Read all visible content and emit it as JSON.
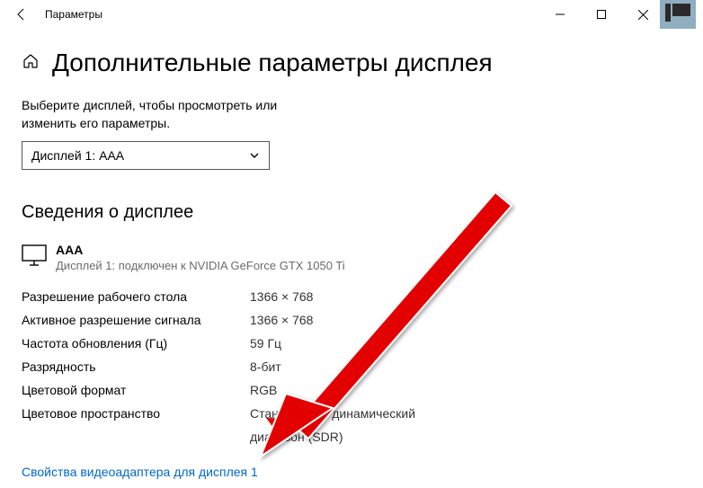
{
  "window": {
    "title": "Параметры"
  },
  "page": {
    "title": "Дополнительные параметры дисплея",
    "instruction": "Выберите дисплей, чтобы просмотреть или изменить его параметры."
  },
  "displaySelect": {
    "value": "Дисплей 1: AAA"
  },
  "section": {
    "title": "Сведения о дисплее"
  },
  "display": {
    "name": "AAA",
    "detail": "Дисплей 1: подключен к NVIDIA GeForce GTX 1050 Ti"
  },
  "rows": {
    "desktopResLabel": "Разрешение рабочего стола",
    "desktopResValue": "1366 × 768",
    "activeResLabel": "Активное разрешение сигнала",
    "activeResValue": "1366 × 768",
    "refreshLabel": "Частота обновления (Гц)",
    "refreshValue": "59 Гц",
    "bitDepthLabel": "Разрядность",
    "bitDepthValue": "8-бит",
    "colorFormatLabel": "Цветовой формат",
    "colorFormatValue": "RGB",
    "colorSpaceLabel": "Цветовое пространство",
    "colorSpaceValue1": "Стандартный динамический",
    "colorSpaceValue2": "диапазон (SDR)"
  },
  "link": {
    "text": "Свойства видеоадаптера для дисплея 1"
  }
}
